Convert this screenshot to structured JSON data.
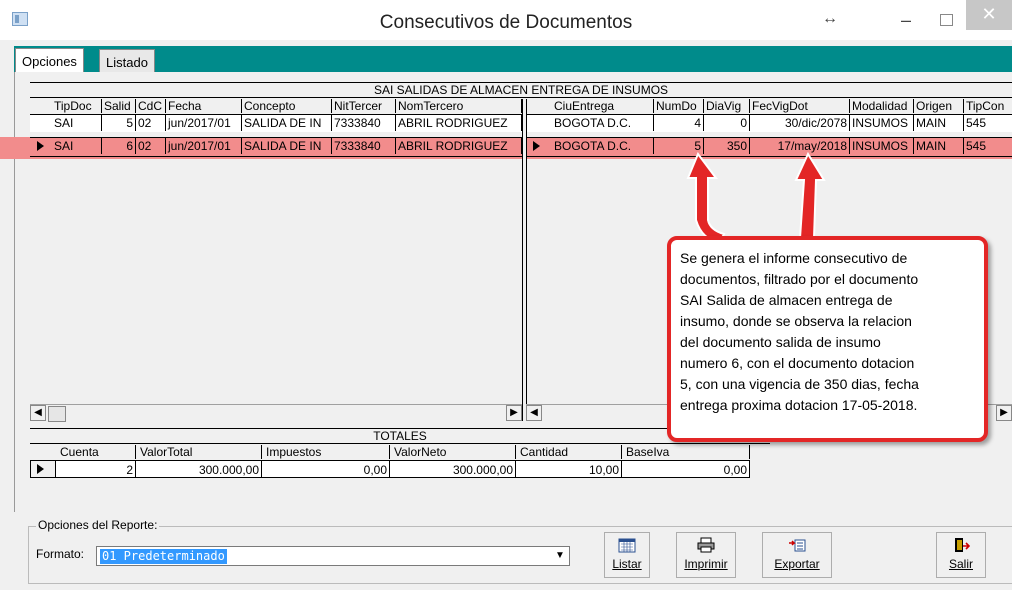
{
  "window": {
    "title": "Consecutivos de Documentos",
    "resize_glyph": "↔",
    "min_glyph": "–",
    "close_glyph": "✕"
  },
  "tabs": [
    {
      "label": "Opciones"
    },
    {
      "label": "Listado"
    }
  ],
  "grid": {
    "title": "SAI  SALIDAS DE ALMACEN ENTREGA DE INSUMOS",
    "left_columns": [
      "TipDoc",
      "Salid",
      "CdC",
      "Fecha",
      "Concepto",
      "NitTercer",
      "NomTercero"
    ],
    "right_columns": [
      "CiuEntrega",
      "NumDo",
      "DiaVig",
      "FecVigDot",
      "Modalidad",
      "Origen",
      "TipCon"
    ],
    "rows": [
      {
        "tipdoc": "SAI",
        "salid": "5",
        "cdc": "02",
        "fecha": "01/jun/2017",
        "concepto": "SALIDA DE IN",
        "nit": "7333840",
        "nom": "ABRIL RODRIGUEZ",
        "ciu": "BOGOTA D.C.",
        "numdo": "4",
        "diavig": "0",
        "fecvig": "30/dic/2078",
        "modalidad": "INSUMOS",
        "origen": "MAIN",
        "tipcon": "545"
      },
      {
        "tipdoc": "SAI",
        "salid": "6",
        "cdc": "02",
        "fecha": "01/jun/2017",
        "concepto": "SALIDA DE IN",
        "nit": "7333840",
        "nom": "ABRIL RODRIGUEZ",
        "ciu": "BOGOTA D.C.",
        "numdo": "5",
        "diavig": "350",
        "fecvig": "17/may/2018",
        "modalidad": "INSUMOS",
        "origen": "MAIN",
        "tipcon": "545"
      }
    ]
  },
  "totals": {
    "title": "TOTALES",
    "columns": [
      "Cuenta",
      "ValorTotal",
      "Impuestos",
      "ValorNeto",
      "Cantidad",
      "BaseIva"
    ],
    "values": [
      "2",
      "300.000,00",
      "0,00",
      "300.000,00",
      "10,00",
      "0,00"
    ]
  },
  "options": {
    "legend": "Opciones del Reporte:",
    "format_label": "Formato:",
    "format_value": "01 Predeterminado",
    "buttons": {
      "listar": "Listar",
      "imprimir": "Imprimir",
      "exportar": "Exportar",
      "salir": "Salir"
    }
  },
  "annotation": {
    "lines": [
      "Se genera el informe consecutivo de",
      "documentos, filtrado por el documento",
      "SAI Salida de almacen entrega de",
      "insumo, donde se observa la relacion",
      "del documento salida de insumo",
      "numero 6, con el documento dotacion",
      "5, con una vigencia de 350 dias, fecha",
      "entrega proxima dotacion 17-05-2018."
    ],
    "color": "#e32626"
  },
  "colors": {
    "tab_strip": "#008b8b",
    "selected_row": "#f28c8c",
    "selection_blue": "#3399ff"
  }
}
